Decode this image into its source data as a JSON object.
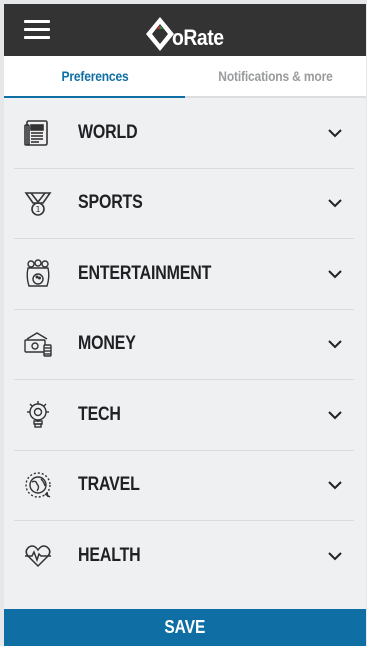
{
  "header": {
    "logo_text": "oRate",
    "menu_icon": "hamburger-icon"
  },
  "tabs": [
    {
      "label": "Preferences",
      "active": true
    },
    {
      "label": "Notifications & more",
      "active": false
    }
  ],
  "categories": [
    {
      "label": "WORLD",
      "icon": "newspaper-icon"
    },
    {
      "label": "SPORTS",
      "icon": "medal-icon"
    },
    {
      "label": "ENTERTAINMENT",
      "icon": "bowling-icon"
    },
    {
      "label": "MONEY",
      "icon": "money-icon"
    },
    {
      "label": "TECH",
      "icon": "lightbulb-gear-icon"
    },
    {
      "label": "TRAVEL",
      "icon": "globe-plane-icon"
    },
    {
      "label": "HEALTH",
      "icon": "heartbeat-icon"
    }
  ],
  "save_label": "SAVE",
  "colors": {
    "accent": "#0f6fa4",
    "header_bg": "#333334",
    "logo_green": "#2f8a3a",
    "logo_red": "#c8312a"
  }
}
